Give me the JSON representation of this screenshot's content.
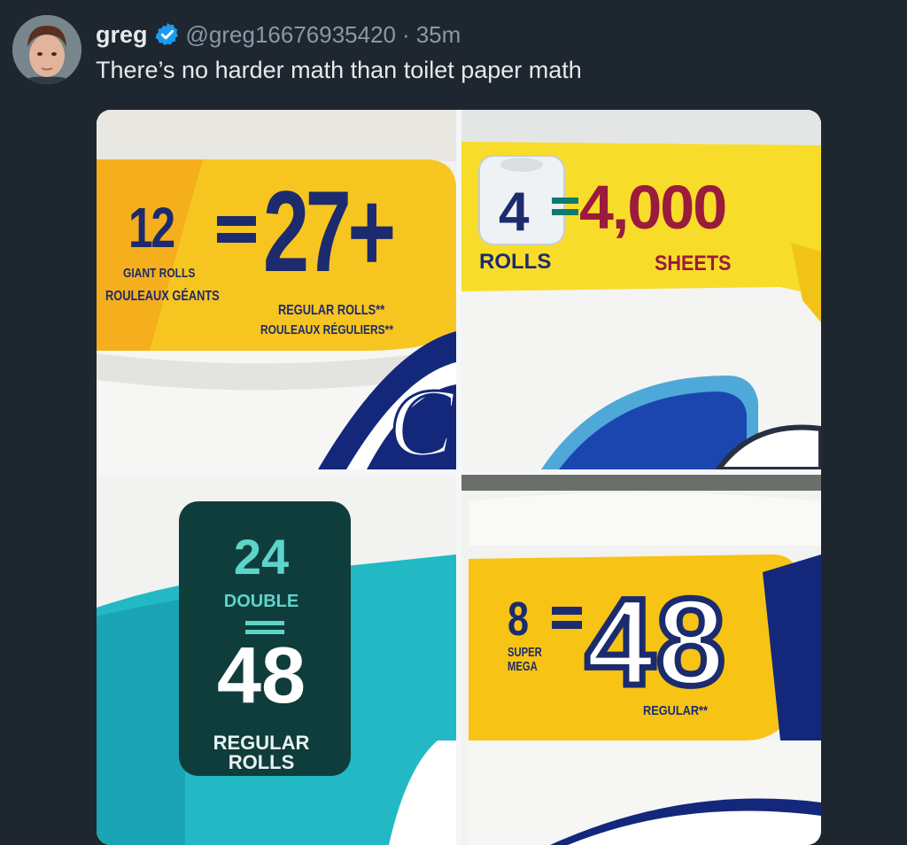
{
  "tweet": {
    "author_name": "greg",
    "handle": "@greg16676935420",
    "separator": "·",
    "time": "35m",
    "text": "There’s no harder math than toilet paper math"
  },
  "media": {
    "panel_1": {
      "count": "12",
      "equals": "27+",
      "giant_label": "GIANT ROLLS",
      "giant_label_fr": "ROULEAUX GÉANTS",
      "regular_label": "REGULAR ROLLS**",
      "regular_label_fr": "ROULEAUX RÉGULIERS**"
    },
    "panel_2": {
      "count": "4",
      "sheets": "4,000",
      "rolls_label": "ROLLS",
      "sheets_label": "SHEETS"
    },
    "panel_3": {
      "count": "24",
      "double_label": "DOUBLE",
      "equals": "48",
      "regular_label": "REGULAR",
      "rolls_label": "ROLLS"
    },
    "panel_4": {
      "count": "8",
      "equals": "48",
      "super_label": "SUPER",
      "mega_label": "MEGA",
      "regular_label": "REGULAR**"
    }
  },
  "colors": {
    "background": "#1e2630",
    "verified_badge": "#1d9bf0",
    "label_yellow": "#f5c400",
    "navy": "#1c2b6e",
    "crimson": "#9a1b3c",
    "teal": "#1cb3c0",
    "dark_teal": "#0f3d3b"
  },
  "icons": {
    "verified": "verified-badge-icon"
  }
}
